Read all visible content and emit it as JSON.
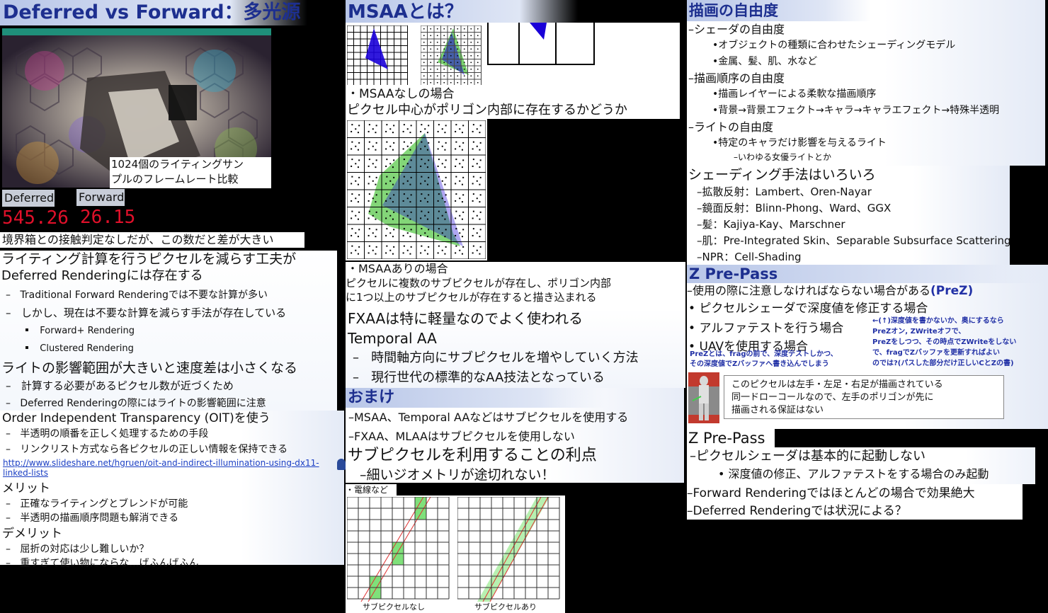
{
  "col1": {
    "title": "Deferred vs Forward：多光源",
    "video_caption_1": "1024個のライティングサン",
    "video_caption_2": "プルのフレームレート比較",
    "deferred_label": "Deferred",
    "deferred_fps": "545.26",
    "forward_label": "Forward",
    "forward_fps": "26.15",
    "note": "境界箱との接触判定なしだが、この数だと差が大きい",
    "s1_title": "ライティング計算を行うピクセルを減らす工夫が",
    "s1_title2": "Deferred Renderingには存在する",
    "s1_b1": "Traditional Forward Renderingでは不要な計算が多い",
    "s1_b2": "しかし、現在は不要な計算を減らす手法が存在している",
    "s1_b3": "Forward+ Rendering",
    "s1_b4": "Clustered Rendering",
    "s2_title": "ライトの影響範囲が大きいと速度差は小さくなる",
    "s2_b1": "計算する必要があるピクセル数が近づくため",
    "s2_b2": "Deferred Renderingの際にはライトの影響範囲に注意",
    "s3_title": "Order Independent Transparency (OIT)を使う",
    "s3_b1": "半透明の順番を正しく処理するための手段",
    "s3_b2": "リンクリスト方式なら各ピクセルの正しい情報を保持できる",
    "s3_link1": "http://www.slideshare.net/hgruen/oit-and-indirect-illumination-using-dx11-",
    "s3_link2": "linked-lists",
    "merit_title": "メリット",
    "merit_b1": "正確なライティングとブレンドが可能",
    "merit_b2": "半透明の描画順序問題も解消できる",
    "demerit_title": "デメリット",
    "demerit_b1": "屈折の対応は少し難しいか？",
    "demerit_b2": "重すぎて使い物にならな…げふんげふん"
  },
  "col2": {
    "title": "MSAAとは？",
    "no_msaa_label": "・MSAAなしの場合",
    "no_msaa_desc": "ピクセル中心がポリゴン内部に存在するかどうか",
    "msaa_label": "・MSAAありの場合",
    "msaa_desc1": "ピクセルに複数のサブピクセルが存在し、ポリゴン内部",
    "msaa_desc2": "に1つ以上のサブピクセルが存在すると描き込まれる",
    "fxaa": "FXAAは特に軽量なのでよく使われる",
    "taa_title": "Temporal AA",
    "taa_b1": "時間軸方向にサブピクセルを増やしていく方法",
    "taa_b2": "現行世代の標準的なAA技法となっている",
    "omake_title": "おまけ",
    "omake_b1": "MSAA、Temporal AAなどはサブピクセルを使用する",
    "omake_b2": "FXAA、MLAAはサブピクセルを使用しない",
    "sub_title": "サブピクセルを利用することの利点",
    "sub_b1": "細いジオメトリが途切れない！",
    "wire_label": "・電線など",
    "fig_left": "サブピクセルなし",
    "fig_right": "サブピクセルあり"
  },
  "col3": {
    "title": "描画の自由度",
    "shader_title": "シェーダの自由度",
    "shader_b1": "オブジェクトの種類に合わせたシェーディングモデル",
    "shader_b2": "金属、髪、肌、水など",
    "order_title": "描画順序の自由度",
    "order_b1": "描画レイヤーによる柔軟な描画順序",
    "order_b2": "背景→背景エフェクト→キャラ→キャラエフェクト→特殊半透明",
    "light_title": "ライトの自由度",
    "light_b1": "特定のキャラだけ影響を与えるライト",
    "light_b2": "いわゆる女優ライトとか",
    "shading_title": "シェーディング手法はいろいろ",
    "shading_b1": "拡散反射：Lambert、Oren-Nayar",
    "shading_b2": "鏡面反射：Blinn-Phong、Ward、GGX",
    "shading_b3": "髪：Kajiya-Kay、Marschner",
    "shading_b4": "肌：Pre-Integrated Skin、Separable Subsurface Scattering",
    "shading_b5": "NPR：Cell-Shading",
    "zpp_title": "Z Pre-Pass",
    "zpp_t1": "使用の際に注意しなければならない場合がある",
    "zpp_prez": "(PreZ)",
    "zpp_b1": "ピクセルシェーダで深度値を修正する場合",
    "zpp_b2": "アルファテストを行う場合",
    "zpp_b3": "UAVを使用する場合",
    "zpp_note_left1": "PreZとは、fragの前で、深度テストしかつ、",
    "zpp_note_left2": "その深度値でZバッファへ書き込んでしまう",
    "zpp_note_right1": "←(↑)深度値を書かないか、奥にするなら",
    "zpp_note_right2": "PreZオン, ZWriteオフで、",
    "zpp_note_right3": "PreZをしつつ、その時点でZWriteをしない",
    "zpp_note_right4": "で、fragでZバッファを更新すればよい",
    "zpp_note_right5": "のでは?(パスした部分だけ正しいCとZの書)",
    "callout1": "このピクセルは左手・左足・右足が描画されている",
    "callout2": "同一ドローコールなので、左手のポリゴンが先に",
    "callout3": "描画される保証はない",
    "zpp2_title": "Z Pre-Pass",
    "zpp2_b1": "ピクセルシェーダは基本的に起動しない",
    "zpp2_b2": "深度値の修正、アルファテストをする場合のみ起動",
    "zpp2_b3": "Forward Renderingではほとんどの場合で効果絶大",
    "zpp2_b4": "Deferred Renderingでは状況による？"
  },
  "colors": {
    "title_blue": "#1d2f8f",
    "fps_red": "#e0102a",
    "triangle_blue": "#1a00d8",
    "fill_green": "#4fc43f"
  }
}
